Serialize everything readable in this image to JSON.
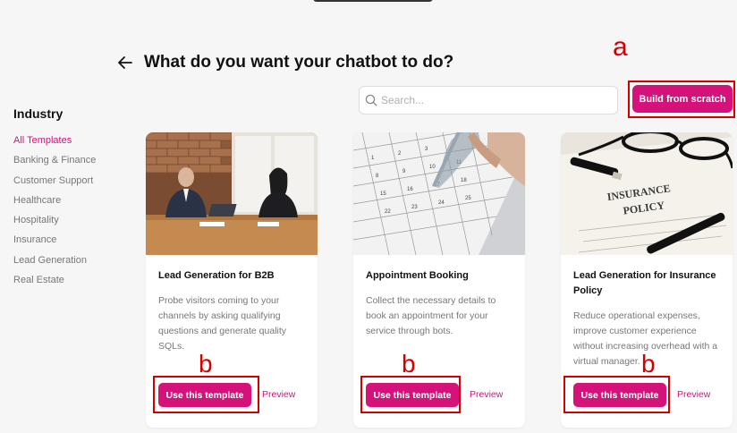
{
  "header": {
    "title": "What do you want your chatbot to do?"
  },
  "search": {
    "placeholder": "Search..."
  },
  "build_button": {
    "label": "Build from scratch"
  },
  "annotations": {
    "a": "a",
    "b": "b"
  },
  "sidebar": {
    "heading": "Industry",
    "items": [
      {
        "label": "All Templates",
        "active": true
      },
      {
        "label": "Banking & Finance"
      },
      {
        "label": "Customer Support"
      },
      {
        "label": "Healthcare"
      },
      {
        "label": "Hospitality"
      },
      {
        "label": "Insurance"
      },
      {
        "label": "Lead Generation"
      },
      {
        "label": "Real Estate"
      }
    ]
  },
  "cards": [
    {
      "title": "Lead Generation for B2B",
      "description": "Probe visitors coming to your channels by asking qualifying questions and generate quality SQLs.",
      "use_label": "Use this template",
      "preview_label": "Preview"
    },
    {
      "title": "Appointment Booking",
      "description": "Collect the necessary details to book an appointment for your service through bots.",
      "use_label": "Use this template",
      "preview_label": "Preview"
    },
    {
      "title": "Lead Generation for Insurance Policy",
      "description": "Reduce operational expenses, improve customer experience without increasing overhead with a virtual manager.",
      "use_label": "Use this template",
      "preview_label": "Preview"
    }
  ],
  "colors": {
    "accent": "#d5127a",
    "annotation": "#d40000"
  }
}
